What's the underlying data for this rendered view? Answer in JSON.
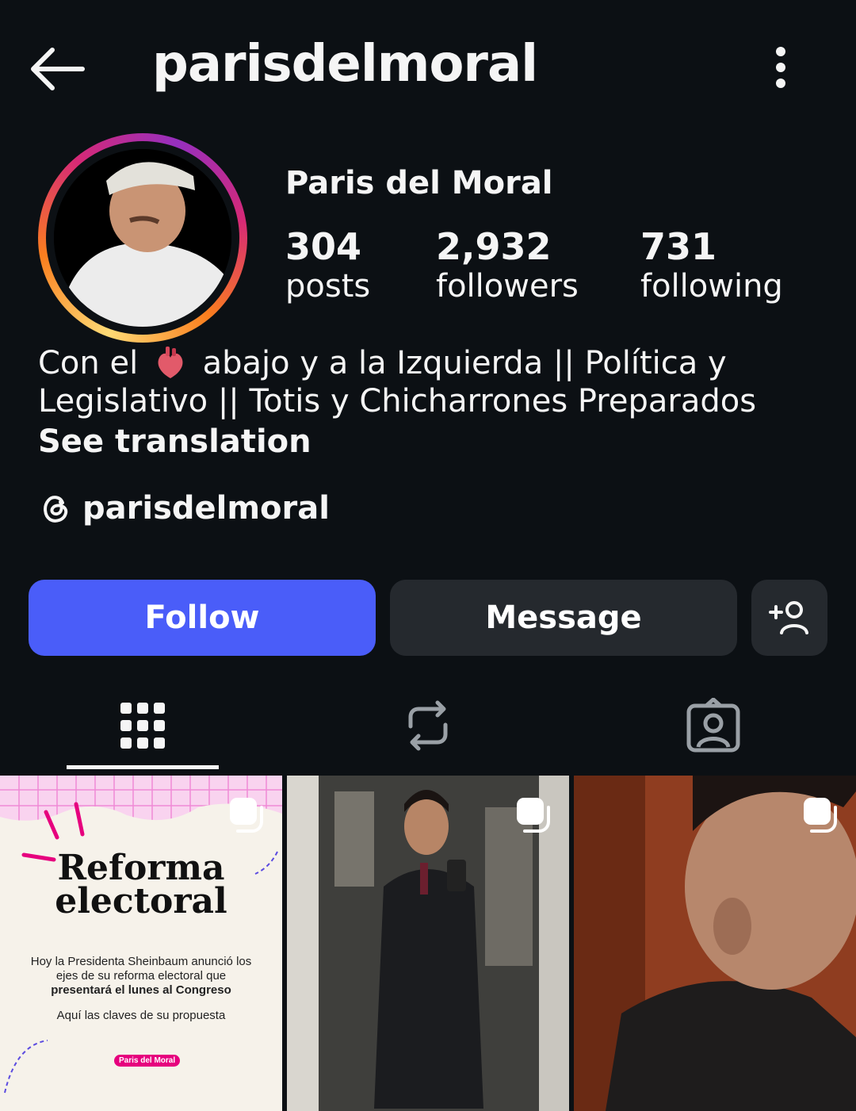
{
  "header": {
    "username": "parisdelmoral"
  },
  "profile": {
    "display_name": "Paris del Moral",
    "stats": [
      {
        "value": "304",
        "label": "posts"
      },
      {
        "value": "2,932",
        "label": "followers"
      },
      {
        "value": "731",
        "label": "following"
      }
    ],
    "bio_before_emoji": "Con el",
    "bio_after_emoji": "abajo y a la Izquierda || Política y",
    "bio_line2": "Legislativo || Totis y Chicharrones Preparados",
    "see_translation": "See translation",
    "threads_handle": "parisdelmoral"
  },
  "actions": {
    "follow": "Follow",
    "message": "Message"
  },
  "tabs": [
    "grid-icon",
    "reposts-icon",
    "tagged-icon"
  ],
  "posts": [
    {
      "title_line1": "Reforma",
      "title_line2": "electoral",
      "body_line1": "Hoy la Presidenta Sheinbaum anunció los",
      "body_line2": "ejes de su reforma electoral que",
      "body_line3": "presentará el lunes al Congreso",
      "body_line4": "Aquí las claves de su propuesta",
      "tag": "Paris del Moral"
    }
  ],
  "colors": {
    "background": "#0c1014",
    "follow": "#4a5df9",
    "secondary": "#25292e",
    "tag": "#e6007e"
  }
}
